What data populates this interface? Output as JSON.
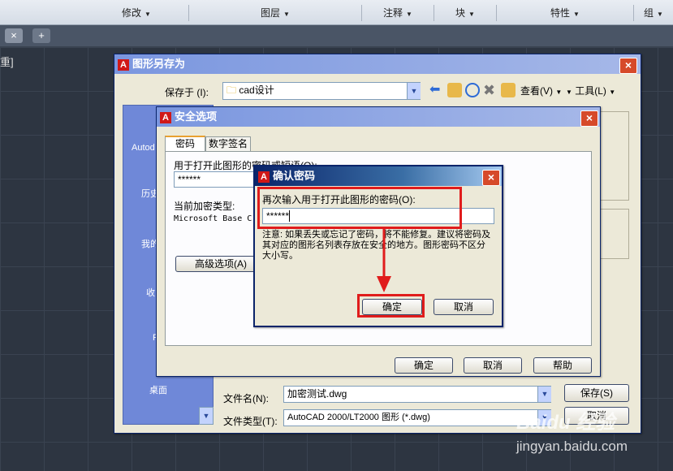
{
  "ribbon": {
    "groups": [
      "修改",
      "图层",
      "注释",
      "块",
      "特性",
      "组"
    ]
  },
  "canvas_note": "重]",
  "save_dialog": {
    "title": "图形另存为",
    "save_in_label": "保存于 (I):",
    "save_in_value": "cad设计",
    "views_label": "查看(V)",
    "tools_label": "工具(L)",
    "sidebar": [
      "Autod",
      "历史",
      "我的",
      "收",
      "F",
      "桌面"
    ],
    "filename_label": "文件名(N):",
    "filename_value": "加密测试.dwg",
    "filetype_label": "文件类型(T):",
    "filetype_value": "AutoCAD 2000/LT2000 图形 (*.dwg)",
    "save_button": "保存(S)",
    "cancel_button": "取消"
  },
  "security_dialog": {
    "title": "安全选项",
    "tabs": [
      "密码",
      "数字签名"
    ],
    "password_label": "用于打开此图形的密码或短语(O):",
    "password_value": "******",
    "encryption_label": "当前加密类型:",
    "encryption_value": "Microsoft Base Cr",
    "advanced_button": "高级选项(A)",
    "ok_button": "确定",
    "cancel_button": "取消",
    "help_button": "帮助"
  },
  "confirm_dialog": {
    "title": "确认密码",
    "prompt": "再次输入用于打开此图形的密码(O):",
    "password_value": "******",
    "note": "注意: 如果丢失或忘记了密码，将不能修复。建议将密码及其对应的图形名列表存放在安全的地方。图形密码不区分大小写。",
    "ok_button": "确定",
    "cancel_button": "取消"
  },
  "watermark": {
    "brand": "Baidu 经验",
    "url": "jingyan.baidu.com"
  },
  "colors": {
    "highlight": "#e01c1c",
    "title_active": "#0a246a",
    "dialog_bg": "#ece9d8"
  }
}
